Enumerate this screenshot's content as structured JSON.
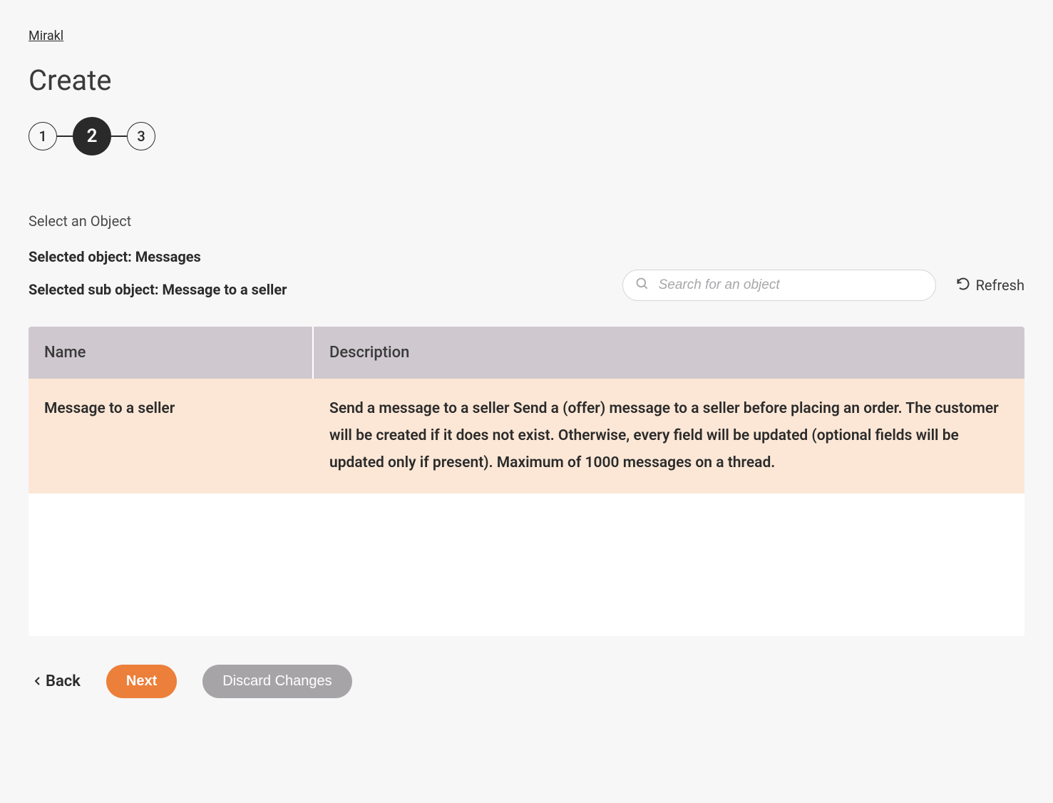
{
  "breadcrumb": "Mirakl",
  "page_title": "Create",
  "stepper": {
    "steps": [
      "1",
      "2",
      "3"
    ],
    "active_index": 1
  },
  "section_label": "Select an Object",
  "selected_object_line": "Selected object: Messages",
  "selected_sub_object_line": "Selected sub object: Message to a seller",
  "search": {
    "placeholder": "Search for an object"
  },
  "refresh_label": "Refresh",
  "table": {
    "headers": {
      "name": "Name",
      "description": "Description"
    },
    "rows": [
      {
        "name": "Message to a seller",
        "description": "Send a message to a seller Send a (offer) message to a seller before placing an order. The customer will be created if it does not exist. Otherwise, every field will be updated (optional fields will be updated only if present). Maximum of 1000 messages on a thread."
      }
    ]
  },
  "footer": {
    "back": "Back",
    "next": "Next",
    "discard": "Discard Changes"
  }
}
